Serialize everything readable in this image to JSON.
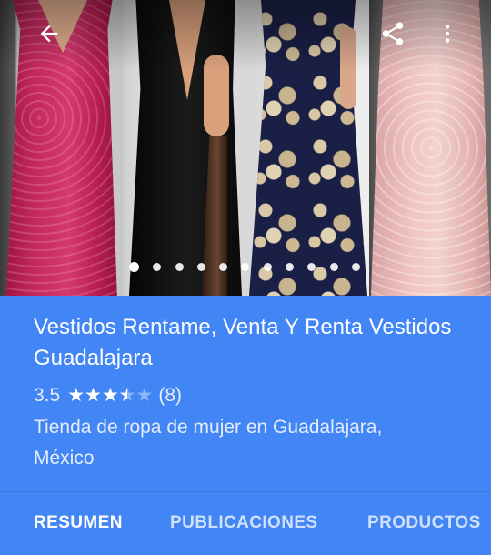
{
  "hero": {
    "photo_count": 11,
    "active_index": 0,
    "panels": [
      "pink-lace-dress",
      "black-dress",
      "navy-floral-dress",
      "blush-pink-dress"
    ]
  },
  "toolbar": {
    "back_icon": "arrow-back-icon",
    "share_icon": "share-icon",
    "more_icon": "more-vert-icon"
  },
  "place": {
    "title": "Vestidos Rentame, Venta Y Renta Vestidos Guadalajara",
    "rating": "3.5",
    "rating_value": 3.5,
    "rating_max": 5,
    "review_count": "(8)",
    "category": "Tienda de ropa de mujer en Guadalajara, México"
  },
  "tabs": [
    {
      "label": "RESUMEN",
      "active": true
    },
    {
      "label": "PUBLICACIONES",
      "active": false
    },
    {
      "label": "PRODUCTOS",
      "active": false
    }
  ],
  "colors": {
    "primary": "#4285f4",
    "on_primary": "#ffffff"
  }
}
